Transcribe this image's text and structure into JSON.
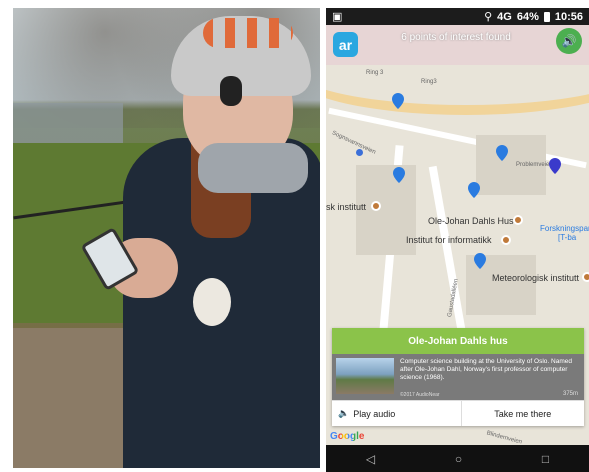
{
  "status": {
    "time": "10:56",
    "battery": "64%",
    "signal": "4G"
  },
  "header": {
    "found_text": "6 points of interest found",
    "logo_text": "ar",
    "audio_icon": "volume-icon"
  },
  "map": {
    "labels": [
      {
        "text": "Ring 3",
        "type": "road"
      },
      {
        "text": "Ring3",
        "type": "road"
      },
      {
        "text": "Problemveien",
        "type": "road"
      },
      {
        "text": "Gaustadalléen",
        "type": "road"
      },
      {
        "text": "Blindernveien",
        "type": "road"
      },
      {
        "text": "Sognsvannsveien",
        "type": "road"
      },
      {
        "text": "sk institutt",
        "type": "poi"
      },
      {
        "text": "Ole-Johan Dahls Hus",
        "type": "poi"
      },
      {
        "text": "Institut for informatikk",
        "type": "poi"
      },
      {
        "text": "Meteorologisk institutt",
        "type": "poi"
      },
      {
        "text": "Forskningspar",
        "type": "poi"
      },
      {
        "text": "[T-ba",
        "type": "poi"
      }
    ],
    "attribution": "Google"
  },
  "card": {
    "title": "Ole-Johan Dahls hus",
    "description": "Computer science building at the University of Oslo. Named after Ole-Johan Dahl, Norway's first professor of computer science (1968).",
    "copyright": "©2017 AudioNear",
    "distance": "375m",
    "play_label": "Play audio",
    "take_label": "Take me there"
  },
  "nav": {
    "back": "◁",
    "home": "○",
    "recent": "□"
  },
  "colors": {
    "accent_green": "#8bc34a",
    "pin_blue": "#2a7be0",
    "logo_blue": "#2aa7e0"
  }
}
